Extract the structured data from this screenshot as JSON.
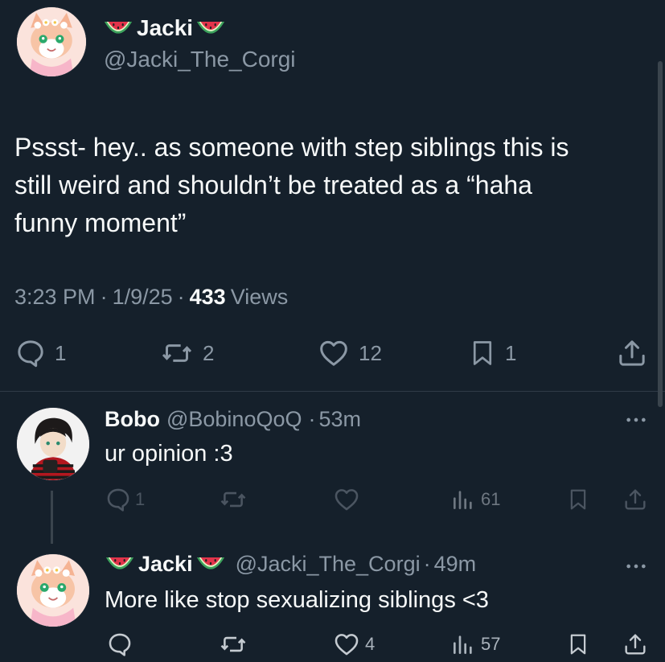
{
  "main_tweet": {
    "display_name": "Jacki",
    "handle": "@Jacki_The_Corgi",
    "text_lines": [
      "Pssst- hey.. as someone with step siblings this is",
      "still weird and shouldn’t be treated as a “haha",
      "funny moment”"
    ],
    "time": "3:23 PM",
    "date": "1/9/25",
    "views_count": "433",
    "views_label": "Views",
    "sep": "·",
    "actions": {
      "replies": "1",
      "reposts": "2",
      "likes": "12",
      "bookmarks": "1"
    }
  },
  "replies": [
    {
      "display_name": "Bobo",
      "handle": "@BobinoQoQ",
      "sep": "·",
      "time": "53m",
      "text": "ur opinion :3",
      "actions": {
        "replies": "1",
        "reposts": "",
        "likes": "",
        "views": "61"
      }
    },
    {
      "display_name": "Jacki",
      "handle": "@Jacki_The_Corgi",
      "sep": "·",
      "time": "49m",
      "text": "More like stop sexualizing siblings <3",
      "actions": {
        "replies": "",
        "reposts": "",
        "likes": "4",
        "views": "57"
      }
    }
  ],
  "icons": {
    "name_emoji": "watermelon-icon",
    "reply": "reply-icon",
    "repost": "repost-icon",
    "like": "heart-icon",
    "bookmark": "bookmark-icon",
    "share": "share-icon",
    "views": "views-icon",
    "more": "more-icon"
  },
  "colors": {
    "background": "#15202b",
    "text": "#f7f9f9",
    "muted": "#8b98a5",
    "watermelon_red": "#e3344b",
    "watermelon_green": "#3da35d"
  }
}
